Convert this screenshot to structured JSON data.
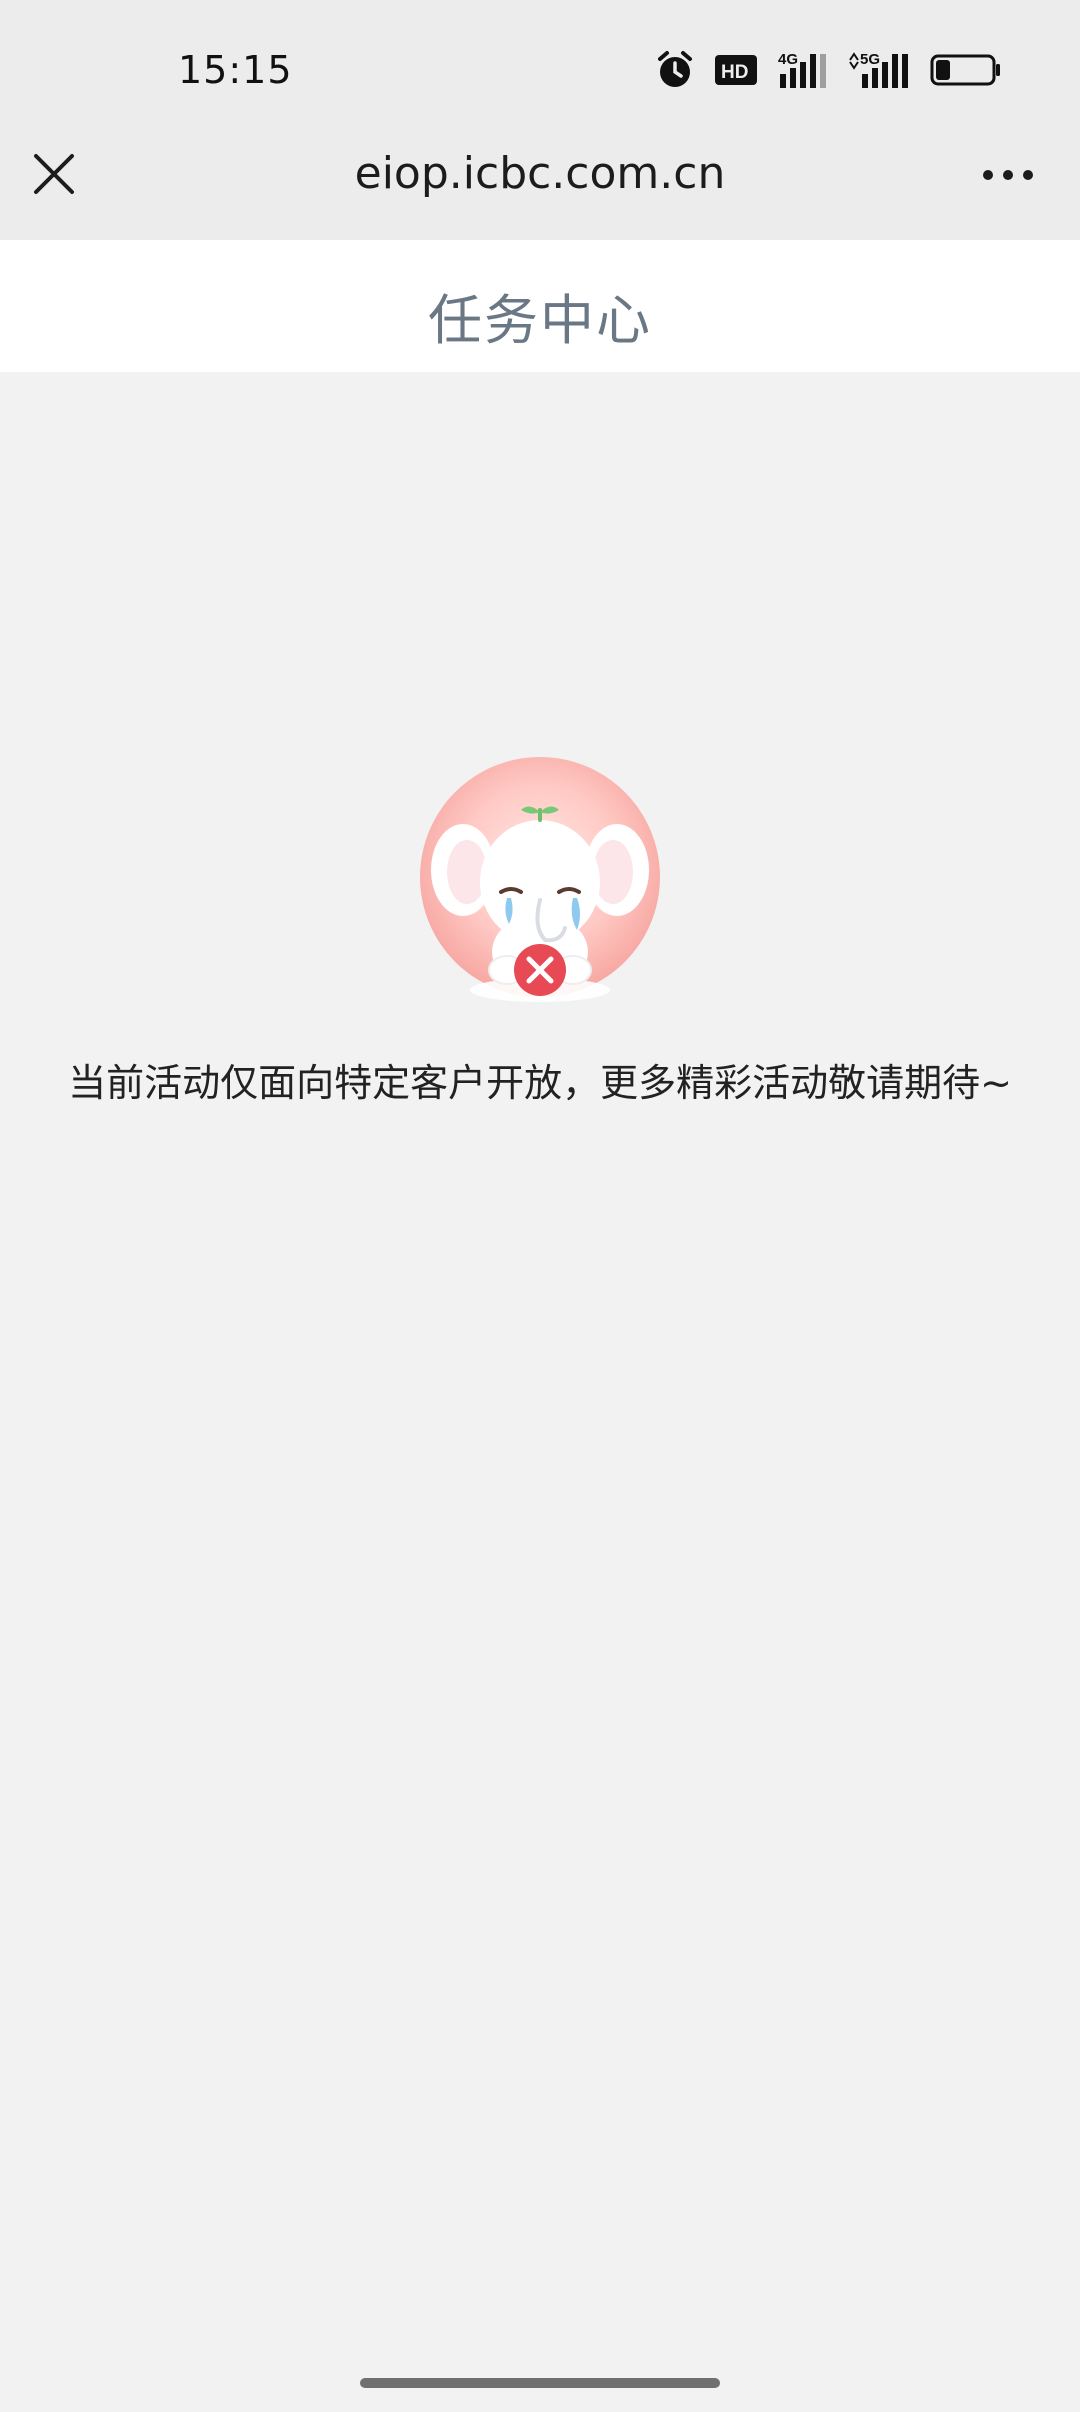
{
  "status_bar": {
    "time": "15:15",
    "icons": [
      "alarm-icon",
      "hd-icon",
      "4g-signal-icon",
      "5g-signal-icon",
      "battery-icon"
    ],
    "hd_text": "HD",
    "network_4g": "4G",
    "network_5g": "5G",
    "battery_level": 0.25
  },
  "browser": {
    "url": "eiop.icbc.com.cn",
    "close_icon": "close-icon",
    "more_icon": "more-icon"
  },
  "page": {
    "title": "任务中心",
    "empty_message": "当前活动仅面向特定客户开放，更多精彩活动敬请期待~"
  },
  "colors": {
    "topbar_bg": "#ececec",
    "page_bg": "#f2f2f2",
    "title": "#6a7785",
    "mascot_circle": "#f7a7a2",
    "error_badge": "#e84a55"
  }
}
